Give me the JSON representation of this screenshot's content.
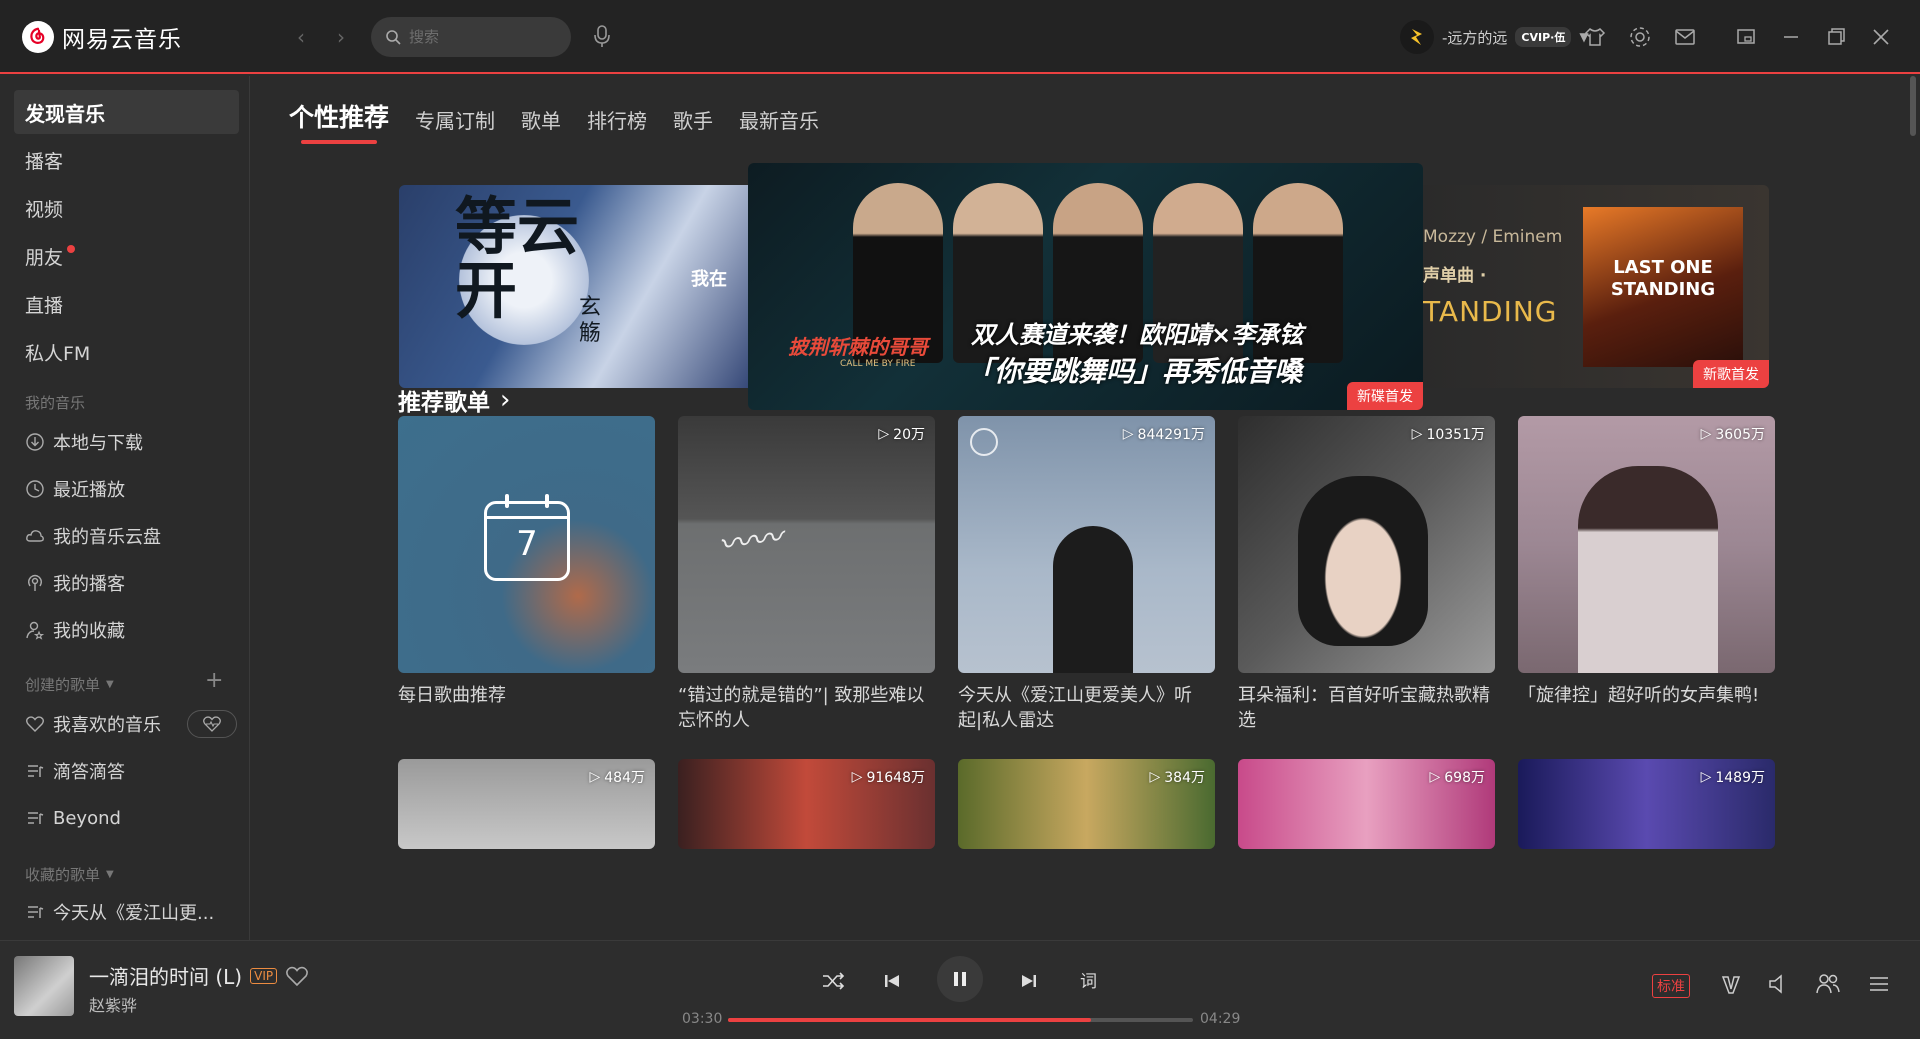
{
  "app": {
    "title": "网易云音乐"
  },
  "search": {
    "placeholder": "搜索"
  },
  "user": {
    "name": "-远方的远",
    "badge": "CVIP·伍"
  },
  "sidebar": {
    "items": [
      {
        "label": "发现音乐"
      },
      {
        "label": "播客"
      },
      {
        "label": "视频"
      },
      {
        "label": "朋友"
      },
      {
        "label": "直播"
      },
      {
        "label": "私人FM"
      }
    ],
    "my_music_header": "我的音乐",
    "my_music": [
      {
        "label": "本地与下载"
      },
      {
        "label": "最近播放"
      },
      {
        "label": "我的音乐云盘"
      },
      {
        "label": "我的播客"
      },
      {
        "label": "我的收藏"
      }
    ],
    "created_header": "创建的歌单",
    "created": [
      {
        "label": "我喜欢的音乐"
      },
      {
        "label": "滴答滴答"
      },
      {
        "label": "Beyond"
      }
    ],
    "collected_header": "收藏的歌单",
    "collected": [
      {
        "label": "今天从《爱江山更..."
      }
    ]
  },
  "tabs": [
    {
      "label": "个性推荐"
    },
    {
      "label": "专属订制"
    },
    {
      "label": "歌单"
    },
    {
      "label": "排行榜"
    },
    {
      "label": "歌手"
    },
    {
      "label": "最新音乐"
    }
  ],
  "banner": {
    "left_calligraphy": "等云开",
    "left_sub": "玄觞",
    "left_text": "我在",
    "center_show": "披荆斩棘的哥哥",
    "center_show_en": "CALL ME BY FIRE",
    "center_line1": "双人赛道来袭！欧阳靖×李承铉",
    "center_line2": "「你要跳舞吗」再秀低音嗓",
    "center_tag": "新碟首发",
    "right_artist": "Mozzy / Eminem",
    "right_sub": "声单曲 ·",
    "right_title": "TANDING",
    "right_album": "LAST ONE STANDING",
    "right_tag": "新歌首发"
  },
  "section": {
    "title": "推荐歌单",
    "arrow": "›"
  },
  "playlists": [
    {
      "title": "每日歌曲推荐",
      "plays": "",
      "day": "7"
    },
    {
      "title": "“错过的就是错的”| 致那些难以忘怀的人",
      "plays": "20万"
    },
    {
      "title": "今天从《爱江山更爱美人》听起|私人雷达",
      "plays": "844291万"
    },
    {
      "title": "耳朵福利：百首好听宝藏热歌精选",
      "plays": "10351万"
    },
    {
      "title": "「旋律控」超好听的女声集鸭!",
      "plays": "3605万"
    }
  ],
  "playlists_row2": [
    {
      "plays": "484万"
    },
    {
      "plays": "91648万"
    },
    {
      "plays": "384万"
    },
    {
      "plays": "698万"
    },
    {
      "plays": "1489万"
    }
  ],
  "player": {
    "title": "一滴泪的时间 (L)",
    "vip": "VIP",
    "artist": "赵紫骅",
    "current": "03:30",
    "total": "04:29",
    "progress": 0.78,
    "lyric": "词",
    "quality": "标准"
  },
  "colors": {
    "accent": "#ec4141",
    "bg": "#2b2b2b"
  }
}
